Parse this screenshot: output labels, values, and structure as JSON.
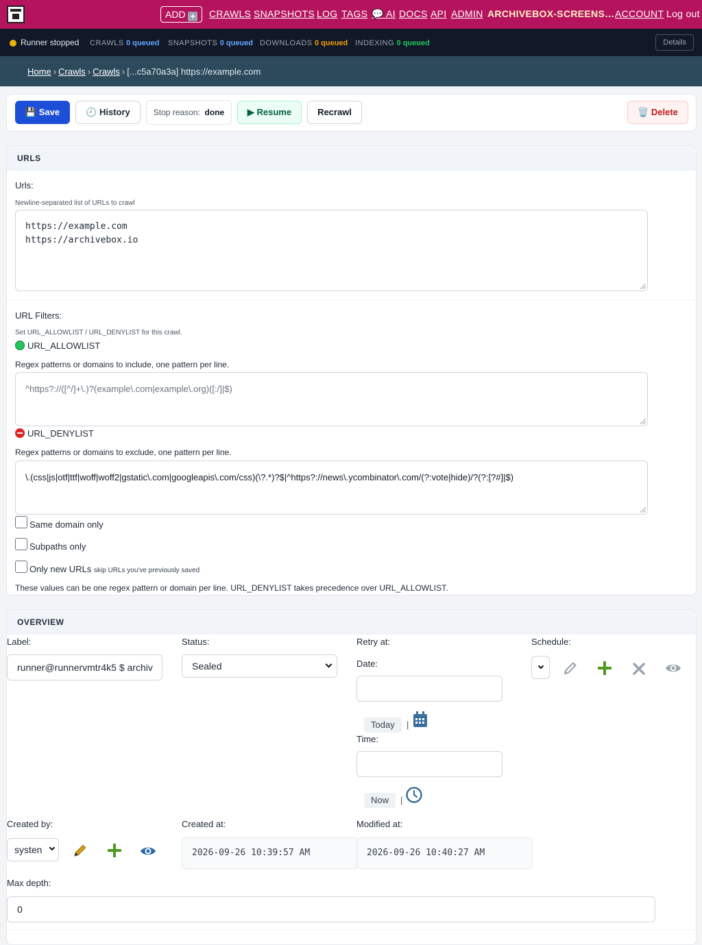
{
  "nav": {
    "add_label": "ADD",
    "items": [
      "CRAWLS",
      "SNAPSHOTS",
      "LOG",
      "TAGS",
      "💬 AI",
      "DOCS",
      "API",
      "ADMIN"
    ],
    "user_label": "ARCHIVEBOX-SCREENS…",
    "account_label": "ACCOUNT",
    "logout_label": "Log out"
  },
  "status": {
    "runner": "Runner stopped",
    "crawls_label": "CRAWLS",
    "crawls_val": "0 queued",
    "snapshots_label": "SNAPSHOTS",
    "snapshots_val": "0 queued",
    "downloads_label": "DOWNLOADS",
    "downloads_val": "0 queued",
    "indexing_label": "INDEXING",
    "indexing_val": "0 queued",
    "details_label": "Details",
    "colors": {
      "crawls": "#60a5fa",
      "snapshots": "#60a5fa",
      "downloads": "#f59e0b",
      "indexing": "#22c55e"
    }
  },
  "breadcrumb": {
    "home": "Home",
    "crawls1": "Crawls",
    "crawls2": "Crawls",
    "current": "[...c5a70a3a] https://example.com"
  },
  "toolbar": {
    "save": "💾 Save",
    "history": "🕘 History",
    "stop_reason_label": "Stop reason:",
    "stop_reason_value": "done",
    "resume": "▶ Resume",
    "recrawl": "Recrawl",
    "delete": "🗑️ Delete"
  },
  "urls_panel": {
    "heading": "URLS",
    "urls_label": "Urls:",
    "urls_help": "Newline-separated list of URLs to crawl",
    "urls_lines": [
      "https://example.com",
      "https://archivebox.io"
    ],
    "filters_label": "URL Filters:",
    "filters_help": "Set URL_ALLOWLIST / URL_DENYLIST for this crawl.",
    "allow_label": "URL_ALLOWLIST",
    "allow_help": "Regex patterns or domains to include, one pattern per line.",
    "allow_placeholder": "^https?://([^/]+\\.)?(example\\.com|example\\.org)([:/]|$)",
    "deny_label": "URL_DENYLIST",
    "deny_help": "Regex patterns or domains to exclude, one pattern per line.",
    "deny_value": "\\.(css|js|otf|ttf|woff|woff2|gstatic\\.com|googleapis\\.com/css)(\\?.*)?$|^https?://news\\.ycombinator\\.com/(?:vote|hide)/?(?:[?#]|$)",
    "same_domain": "Same domain only",
    "subpaths": "Subpaths only",
    "only_new": "Only new URLs",
    "only_new_help": "skip URLs you've previously saved",
    "footer_note": "These values can be one regex pattern or domain per line. URL_DENYLIST takes precedence over URL_ALLOWLIST."
  },
  "overview": {
    "heading": "OVERVIEW",
    "label_label": "Label:",
    "label_value": "runner@runnervmtr4k5 $ archiv",
    "status_label": "Status:",
    "status_value": "Sealed",
    "retry_label": "Retry at:",
    "date_label": "Date:",
    "today": "Today",
    "time_label": "Time:",
    "now": "Now",
    "schedule_label": "Schedule:",
    "created_by_label": "Created by:",
    "created_by_value": "systen",
    "created_at_label": "Created at:",
    "created_at_value": "2026-09-26 10:39:57 AM",
    "modified_at_label": "Modified at:",
    "modified_at_value": "2026-09-26 10:40:27 AM",
    "max_depth_label": "Max depth:",
    "max_depth_value": "0"
  }
}
